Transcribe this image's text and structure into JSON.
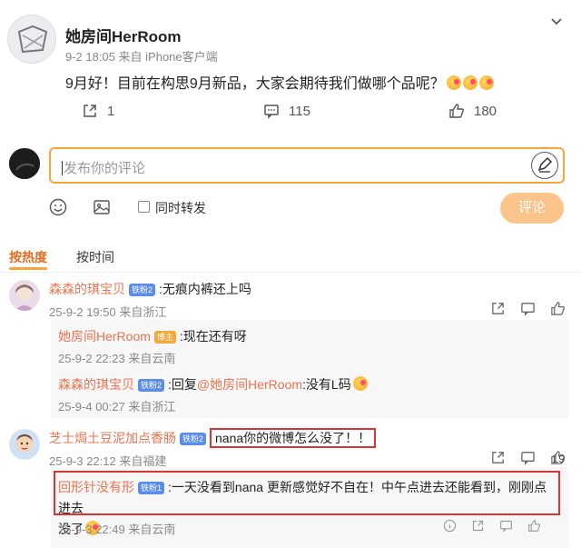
{
  "post": {
    "author": "她房间HerRoom",
    "meta": "9-2 18:05  来自 iPhone客户端",
    "text": "9月好！目前在构思9月新品，大家会期待我们做哪个品呢？",
    "reposts": "1",
    "comments": "115",
    "likes": "180"
  },
  "composer": {
    "placeholder": "发布你的评论",
    "repost_label": "同时转发",
    "submit_label": "评论"
  },
  "sort": {
    "hot": "按热度",
    "time": "按时间"
  },
  "comments": [
    {
      "user": "森森的琪宝贝",
      "badge": "铁粉2",
      "text": ":无痕内裤还上吗",
      "meta": "25-9-2 19:50 来自浙江",
      "replies": [
        {
          "user": "她房间HerRoom",
          "badge": "博主",
          "text": ":现在还有呀",
          "meta": "25-9-2 22:23 来自云南"
        },
        {
          "user": "森森的琪宝贝",
          "badge": "铁粉2",
          "text_prefix": ":回复",
          "mention": "@她房间HerRoom",
          "text": ":没有L码",
          "meta": "25-9-4 00:27 来自浙江"
        }
      ]
    },
    {
      "user": "芝士焗土豆泥加点香肠",
      "badge": "铁粉2",
      "text": "nana你的微博怎么没了！！",
      "meta": "25-9-3 22:12 来自福建",
      "likes": "19",
      "replies": [
        {
          "user": "回形针没有形",
          "badge": "铁粉1",
          "text": ":一天没看到nana 更新感觉好不自在！中午点进去还能看到，刚刚点进去",
          "text2": "没了",
          "meta": "25-9-3 22:49 来自云南"
        }
      ]
    }
  ]
}
